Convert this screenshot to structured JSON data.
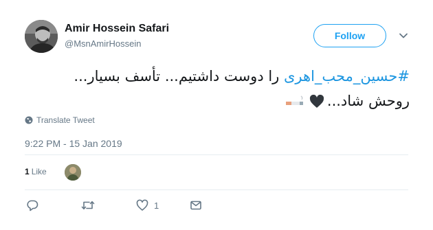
{
  "user": {
    "name": "Amir Hossein Safari",
    "handle": "@MsnAmirHossein"
  },
  "header": {
    "follow_label": "Follow"
  },
  "tweet": {
    "hashtag": "#حسین_محب_اهری",
    "line1_rest": " را دوست داشتیم... تأسف بسیار...",
    "line2_text": "روحش شاد...",
    "translate_label": "Translate Tweet",
    "timestamp": "9:22 PM - 15 Jan 2019"
  },
  "stats": {
    "likes_count": "1",
    "likes_label": "Like"
  },
  "actions": {
    "reply_count": "",
    "retweet_count": "",
    "like_count": "1"
  },
  "colors": {
    "accent": "#1da1f2",
    "hashtag": "#1b95e0",
    "muted": "#657786",
    "divider": "#e6ecf0"
  },
  "icons": [
    "caret-down-icon",
    "globe-icon",
    "black-heart-emoji",
    "cigarette-emoji",
    "reply-icon",
    "retweet-icon",
    "heart-icon",
    "message-icon"
  ]
}
